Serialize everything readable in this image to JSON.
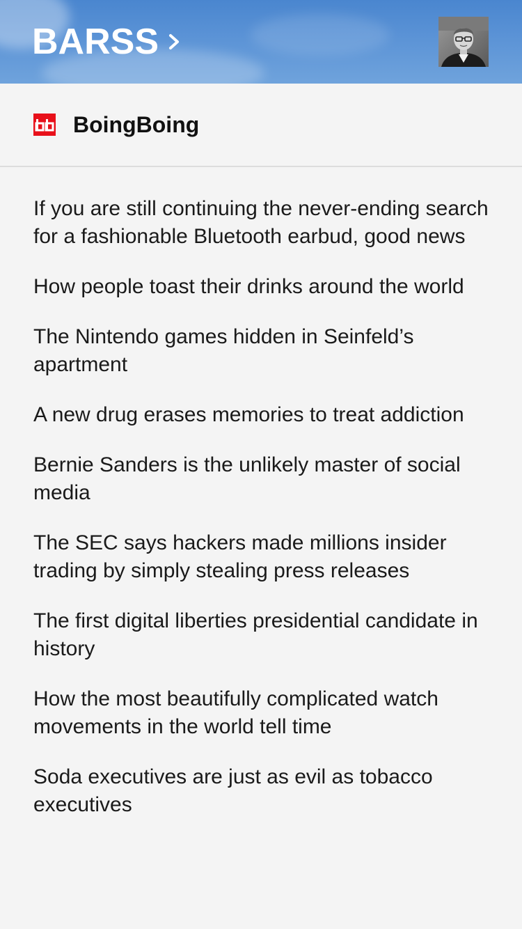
{
  "header": {
    "title": "BARSS",
    "chevron_icon": "chevron-right-icon",
    "avatar_icon": "user-avatar",
    "background_color": "#5b93d6"
  },
  "feed": {
    "name": "BoingBoing",
    "logo_text": "bb",
    "logo_color": "#e8101a"
  },
  "articles": [
    "If you are still continuing the never-ending search for a fashionable Bluetooth earbud, good news",
    "How people toast their drinks around the world",
    "The Nintendo games hidden in Seinfeld’s apartment",
    "A new drug erases memories to treat addiction",
    "Bernie Sanders is the unlikely master of social media",
    "The SEC says hackers made millions insider trading by simply stealing press releases",
    "The first digital liberties presidential candidate in history",
    "How the most beautifully complicated watch movements in the world tell time",
    "Soda executives are just as evil as tobacco executives"
  ]
}
